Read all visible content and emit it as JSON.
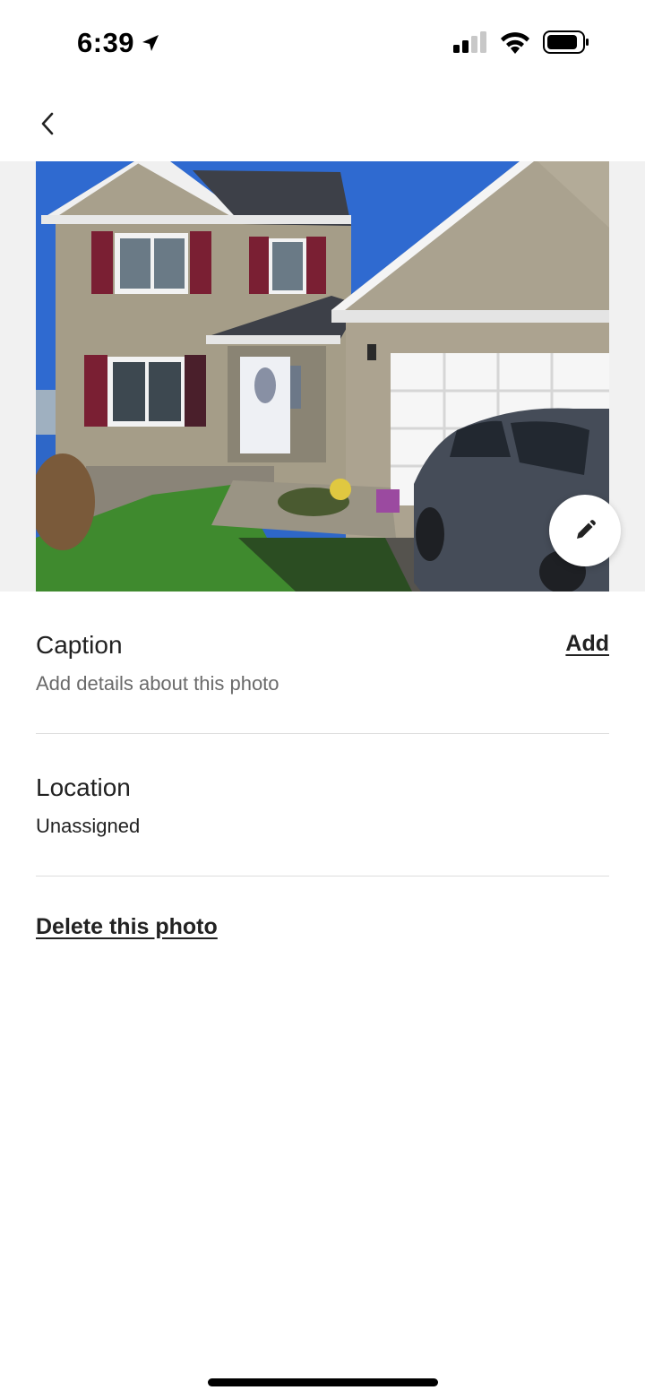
{
  "status_bar": {
    "time": "6:39",
    "icons": [
      "location-arrow-icon",
      "cellular-signal-icon",
      "wifi-icon",
      "battery-icon"
    ]
  },
  "navigation": {
    "back_icon": "chevron-left-icon"
  },
  "photo": {
    "edit_icon": "pencil-icon"
  },
  "caption": {
    "title": "Caption",
    "placeholder": "Add details about this photo",
    "action_label": "Add"
  },
  "location": {
    "title": "Location",
    "value": "Unassigned"
  },
  "delete": {
    "label": "Delete this photo"
  },
  "colors": {
    "text": "#222222",
    "secondary_text": "#6a6a6a",
    "divider": "#dddddd",
    "photo_background": "#f1f1f1"
  }
}
